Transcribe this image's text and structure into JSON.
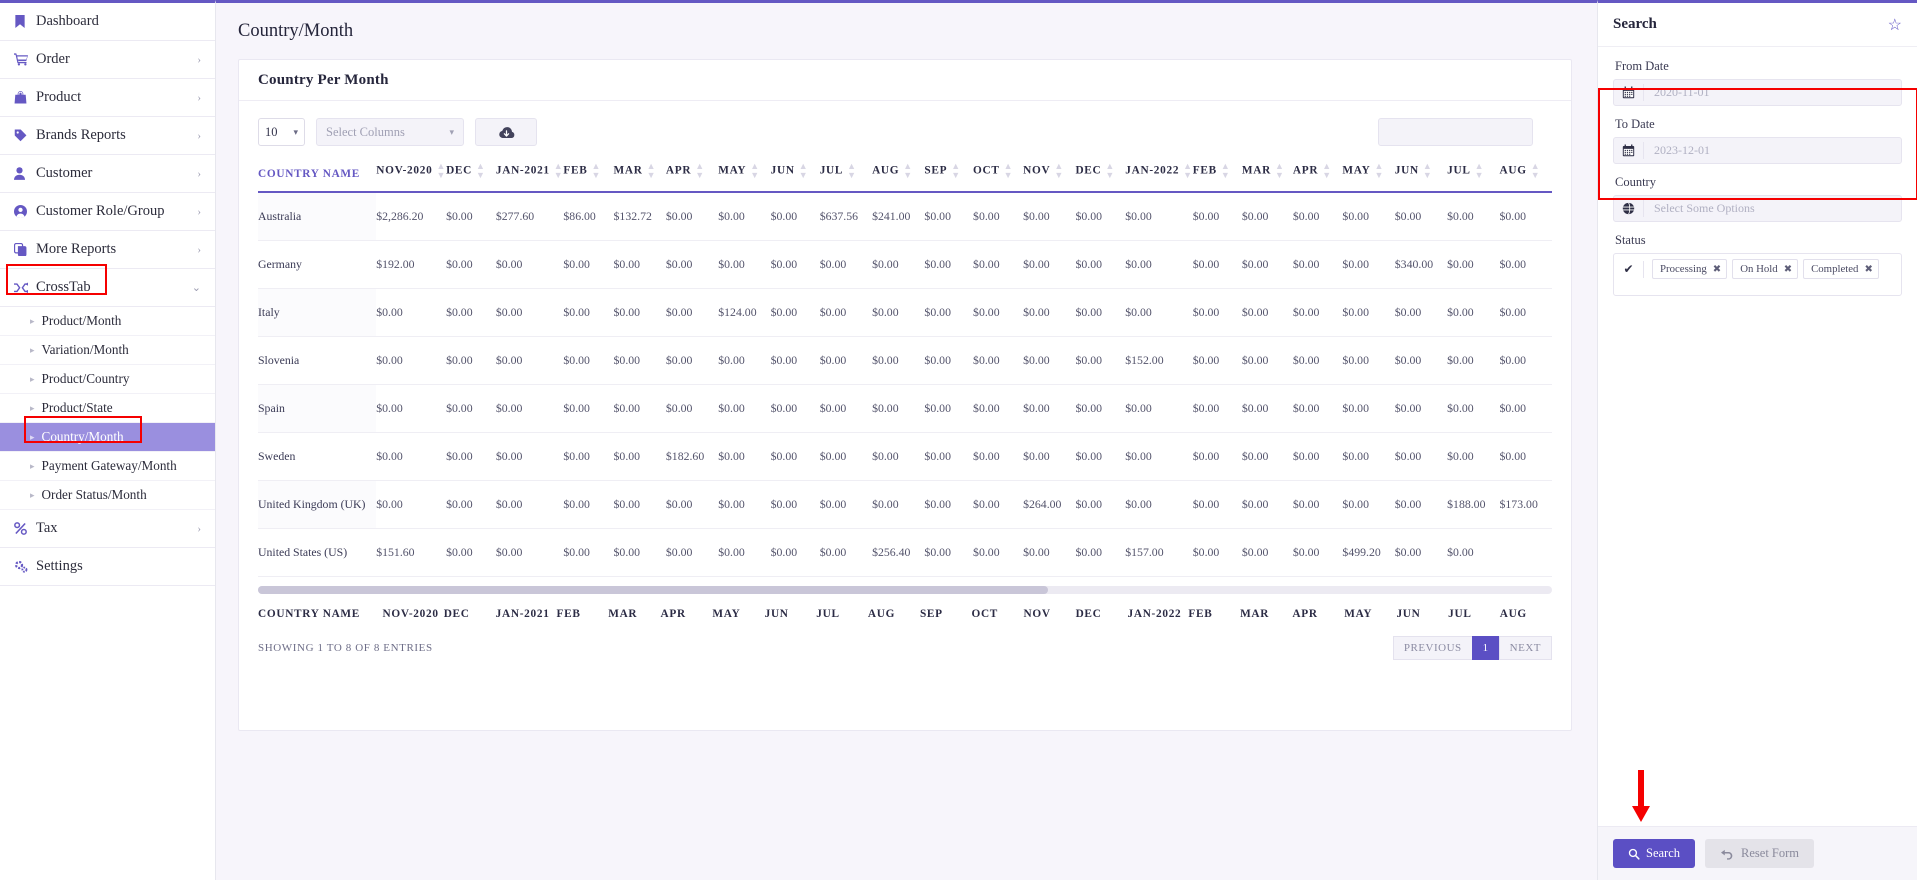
{
  "sidebar": {
    "items": [
      {
        "label": "Dashboard",
        "icon": "bookmark-icon",
        "expandable": false
      },
      {
        "label": "Order",
        "icon": "cart-icon",
        "expandable": true
      },
      {
        "label": "Product",
        "icon": "bag-icon",
        "expandable": true
      },
      {
        "label": "Brands Reports",
        "icon": "tag-icon",
        "expandable": true
      },
      {
        "label": "Customer",
        "icon": "user-icon",
        "expandable": true
      },
      {
        "label": "Customer Role/Group",
        "icon": "user-circle-icon",
        "expandable": true
      },
      {
        "label": "More Reports",
        "icon": "copy-icon",
        "expandable": true
      },
      {
        "label": "CrossTab",
        "icon": "shuffle-icon",
        "expandable": true
      }
    ],
    "sub_items": [
      {
        "label": "Product/Month",
        "selected": false
      },
      {
        "label": "Variation/Month",
        "selected": false
      },
      {
        "label": "Product/Country",
        "selected": false
      },
      {
        "label": "Product/State",
        "selected": false
      },
      {
        "label": "Country/Month",
        "selected": true
      },
      {
        "label": "Payment Gateway/Month",
        "selected": false
      },
      {
        "label": "Order Status/Month",
        "selected": false
      }
    ],
    "tail_items": [
      {
        "label": "Tax",
        "icon": "percent-icon",
        "expandable": true
      },
      {
        "label": "Settings",
        "icon": "gears-icon",
        "expandable": false
      }
    ],
    "caret_glyph": "›",
    "caret_down_glyph": "⌄",
    "triangle_glyph": "▸"
  },
  "main": {
    "page_title": "Country/Month",
    "card_title": "Country Per Month",
    "toolbar": {
      "page_length": "10",
      "select_columns_label": "Select Columns",
      "download_icon": "cloud-download-icon",
      "search_value": ""
    },
    "table": {
      "columns": [
        "COUNTRY NAME",
        "NOV-2020",
        "DEC",
        "JAN-2021",
        "FEB",
        "MAR",
        "APR",
        "MAY",
        "JUN",
        "JUL",
        "AUG",
        "SEP",
        "OCT",
        "NOV",
        "DEC",
        "JAN-2022",
        "FEB",
        "MAR",
        "APR",
        "MAY",
        "JUN",
        "JUL",
        "AUG"
      ],
      "rows": [
        {
          "country": "Australia",
          "values": [
            "$2,286.20",
            "$0.00",
            "$277.60",
            "$86.00",
            "$132.72",
            "$0.00",
            "$0.00",
            "$0.00",
            "$637.56",
            "$241.00",
            "$0.00",
            "$0.00",
            "$0.00",
            "$0.00",
            "$0.00",
            "$0.00",
            "$0.00",
            "$0.00",
            "$0.00",
            "$0.00",
            "$0.00",
            "$0.00"
          ]
        },
        {
          "country": "Germany",
          "values": [
            "$192.00",
            "$0.00",
            "$0.00",
            "$0.00",
            "$0.00",
            "$0.00",
            "$0.00",
            "$0.00",
            "$0.00",
            "$0.00",
            "$0.00",
            "$0.00",
            "$0.00",
            "$0.00",
            "$0.00",
            "$0.00",
            "$0.00",
            "$0.00",
            "$0.00",
            "$340.00",
            "$0.00",
            "$0.00"
          ]
        },
        {
          "country": "Italy",
          "values": [
            "$0.00",
            "$0.00",
            "$0.00",
            "$0.00",
            "$0.00",
            "$0.00",
            "$124.00",
            "$0.00",
            "$0.00",
            "$0.00",
            "$0.00",
            "$0.00",
            "$0.00",
            "$0.00",
            "$0.00",
            "$0.00",
            "$0.00",
            "$0.00",
            "$0.00",
            "$0.00",
            "$0.00",
            "$0.00"
          ]
        },
        {
          "country": "Slovenia",
          "values": [
            "$0.00",
            "$0.00",
            "$0.00",
            "$0.00",
            "$0.00",
            "$0.00",
            "$0.00",
            "$0.00",
            "$0.00",
            "$0.00",
            "$0.00",
            "$0.00",
            "$0.00",
            "$0.00",
            "$152.00",
            "$0.00",
            "$0.00",
            "$0.00",
            "$0.00",
            "$0.00",
            "$0.00",
            "$0.00"
          ]
        },
        {
          "country": "Spain",
          "values": [
            "$0.00",
            "$0.00",
            "$0.00",
            "$0.00",
            "$0.00",
            "$0.00",
            "$0.00",
            "$0.00",
            "$0.00",
            "$0.00",
            "$0.00",
            "$0.00",
            "$0.00",
            "$0.00",
            "$0.00",
            "$0.00",
            "$0.00",
            "$0.00",
            "$0.00",
            "$0.00",
            "$0.00",
            "$0.00"
          ]
        },
        {
          "country": "Sweden",
          "values": [
            "$0.00",
            "$0.00",
            "$0.00",
            "$0.00",
            "$0.00",
            "$182.60",
            "$0.00",
            "$0.00",
            "$0.00",
            "$0.00",
            "$0.00",
            "$0.00",
            "$0.00",
            "$0.00",
            "$0.00",
            "$0.00",
            "$0.00",
            "$0.00",
            "$0.00",
            "$0.00",
            "$0.00",
            "$0.00"
          ]
        },
        {
          "country": "United Kingdom (UK)",
          "values": [
            "$0.00",
            "$0.00",
            "$0.00",
            "$0.00",
            "$0.00",
            "$0.00",
            "$0.00",
            "$0.00",
            "$0.00",
            "$0.00",
            "$0.00",
            "$0.00",
            "$264.00",
            "$0.00",
            "$0.00",
            "$0.00",
            "$0.00",
            "$0.00",
            "$0.00",
            "$0.00",
            "$188.00",
            "$173.00"
          ]
        },
        {
          "country": "United States (US)",
          "values": [
            "$151.60",
            "$0.00",
            "$0.00",
            "$0.00",
            "$0.00",
            "$0.00",
            "$0.00",
            "$0.00",
            "$0.00",
            "$256.40",
            "$0.00",
            "$0.00",
            "$0.00",
            "$0.00",
            "$157.00",
            "$0.00",
            "$0.00",
            "$0.00",
            "$499.20",
            "$0.00",
            "$0.00",
            ""
          ]
        }
      ],
      "footer_columns": [
        "COUNTRY NAME",
        "NOV-2020",
        "DEC",
        "JAN-2021",
        "FEB",
        "MAR",
        "APR",
        "MAY",
        "JUN",
        "JUL",
        "AUG",
        "SEP",
        "OCT",
        "NOV",
        "DEC",
        "JAN-2022",
        "FEB",
        "MAR",
        "APR",
        "MAY",
        "JUN",
        "JUL",
        "AUG"
      ]
    },
    "showing_text": "SHOWING 1 TO 8 OF 8 ENTRIES",
    "pagination": {
      "previous": "PREVIOUS",
      "current": "1",
      "next": "NEXT"
    },
    "fab_icon": "close-icon"
  },
  "right_panel": {
    "title": "Search",
    "star_icon": "star-outline-icon",
    "from_date": {
      "label": "From Date",
      "value": "2020-11-01",
      "icon": "calendar-icon"
    },
    "to_date": {
      "label": "To Date",
      "value": "2023-12-01",
      "icon": "calendar-icon"
    },
    "country": {
      "label": "Country",
      "placeholder": "Select Some Options",
      "icon": "globe-icon"
    },
    "status": {
      "label": "Status",
      "icon": "check-icon",
      "chips": [
        "Processing",
        "On Hold",
        "Completed"
      ],
      "remove_glyph": "✖"
    },
    "search_button": {
      "label": "Search",
      "icon": "search-icon"
    },
    "reset_button": {
      "label": "Reset Form",
      "icon": "undo-icon"
    }
  },
  "annotations": {
    "accent": "#6558c3",
    "highlight": "#f50000",
    "selected_bg": "#9a8fdf"
  }
}
